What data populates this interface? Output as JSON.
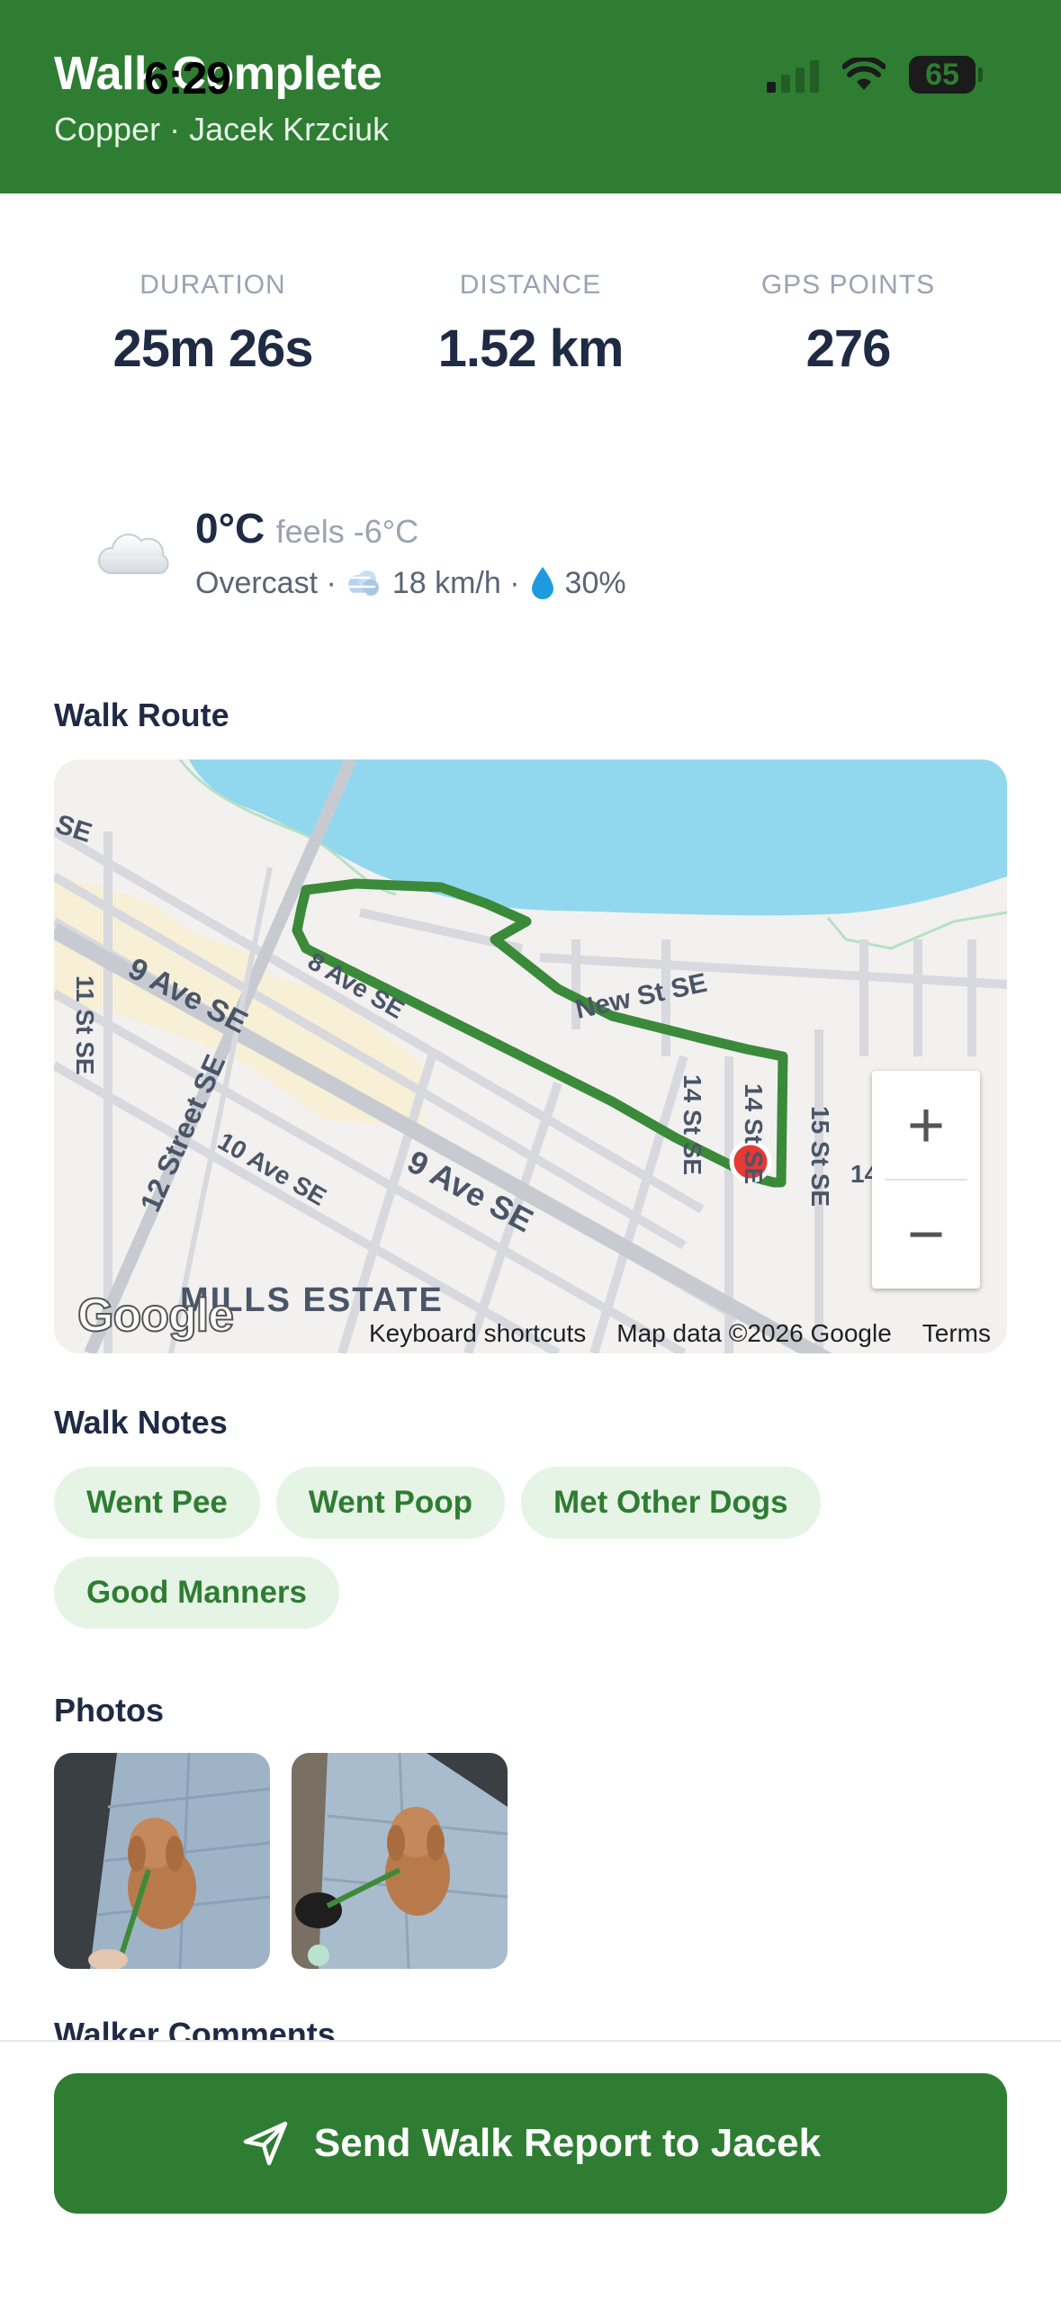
{
  "status_bar": {
    "time": "6:29",
    "battery": "65"
  },
  "header": {
    "title": "Walk Complete",
    "subtitle": "Copper · Jacek Krzciuk"
  },
  "stats": [
    {
      "label": "DURATION",
      "value": "25m 26s"
    },
    {
      "label": "DISTANCE",
      "value": "1.52 km"
    },
    {
      "label": "GPS POINTS",
      "value": "276"
    }
  ],
  "weather": {
    "temp": "0°C",
    "feels": "feels -6°C",
    "condition": "Overcast ·",
    "wind": "18 km/h ·",
    "humidity": "30%"
  },
  "route": {
    "title": "Walk Route",
    "map_labels": {
      "se_top": "SE",
      "ave9_a": "9 Ave SE",
      "ave8": "8 Ave SE",
      "st11": "11 St SE",
      "street12": "12 Street SE",
      "ave10": "10 Ave SE",
      "ave9_b": "9 Ave SE",
      "new_st": "New St SE",
      "st14": "14 St SE",
      "st14b": "14 St SE",
      "st15": "15 St SE",
      "st14c": "14",
      "mills": "MILLS ESTATE"
    },
    "zoom_in": "+",
    "zoom_out": "−",
    "google": "Google",
    "footer": {
      "shortcuts": "Keyboard shortcuts",
      "data": "Map data ©2026 Google",
      "terms": "Terms"
    }
  },
  "notes": {
    "title": "Walk Notes",
    "tags": [
      "Went Pee",
      "Went Poop",
      "Met Other Dogs",
      "Good Manners"
    ]
  },
  "photos": {
    "title": "Photos"
  },
  "comments": {
    "title": "Walker Comments"
  },
  "send_button": {
    "label": "Send Walk Report to Jacek"
  },
  "colors": {
    "brand_green": "#2e7d32",
    "chip_bg": "#e6f4e6",
    "water": "#91d8ee",
    "route": "#3a8a3a",
    "marker": "#e53935"
  }
}
